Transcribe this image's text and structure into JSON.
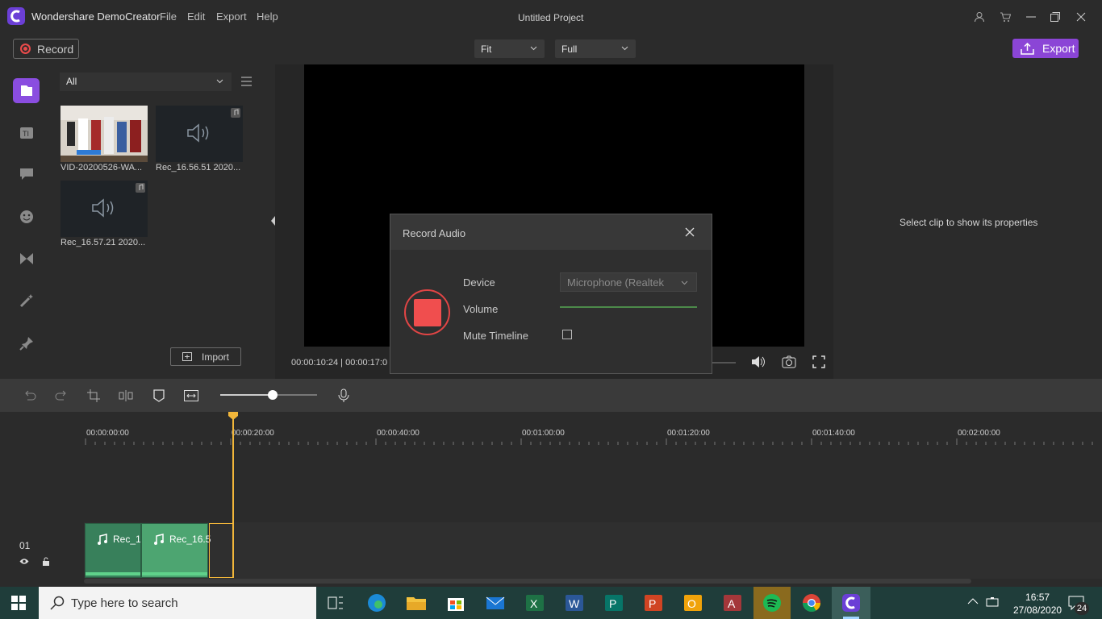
{
  "app": {
    "name": "Wondershare DemoCreator",
    "project_title": "Untitled Project",
    "brand_color": "#6b3fd6"
  },
  "menu": [
    "File",
    "Edit",
    "Export",
    "Help"
  ],
  "toolbar": {
    "record_label": "Record",
    "fit_value": "Fit",
    "full_value": "Full",
    "export_label": "Export"
  },
  "media": {
    "filter_value": "All",
    "items": [
      {
        "name": "VID-20200526-WA...",
        "kind": "video"
      },
      {
        "name": "Rec_16.56.51 2020...",
        "kind": "audio"
      },
      {
        "name": "Rec_16.57.21 2020...",
        "kind": "audio"
      }
    ],
    "import_label": "Import"
  },
  "preview": {
    "timecode": "00:00:10:24 | 00:00:17:0"
  },
  "properties": {
    "empty_text": "Select clip to show its properties"
  },
  "dialog": {
    "title": "Record Audio",
    "device_label": "Device",
    "device_value": "Microphone (Realtek",
    "volume_label": "Volume",
    "mute_label": "Mute Timeline"
  },
  "timeline": {
    "ruler": [
      "00:00:00:00",
      "00:00:20:00",
      "00:00:40:00",
      "00:01:00:00",
      "00:01:20:00",
      "00:01:40:00",
      "00:02:00:00"
    ],
    "track_number": "01",
    "clips": [
      "Rec_1",
      "Rec_16.5"
    ],
    "zoom_fraction": 0.54
  },
  "taskbar": {
    "search_placeholder": "Type here to search",
    "time": "16:57",
    "date": "27/08/2020",
    "notifications": "24"
  }
}
